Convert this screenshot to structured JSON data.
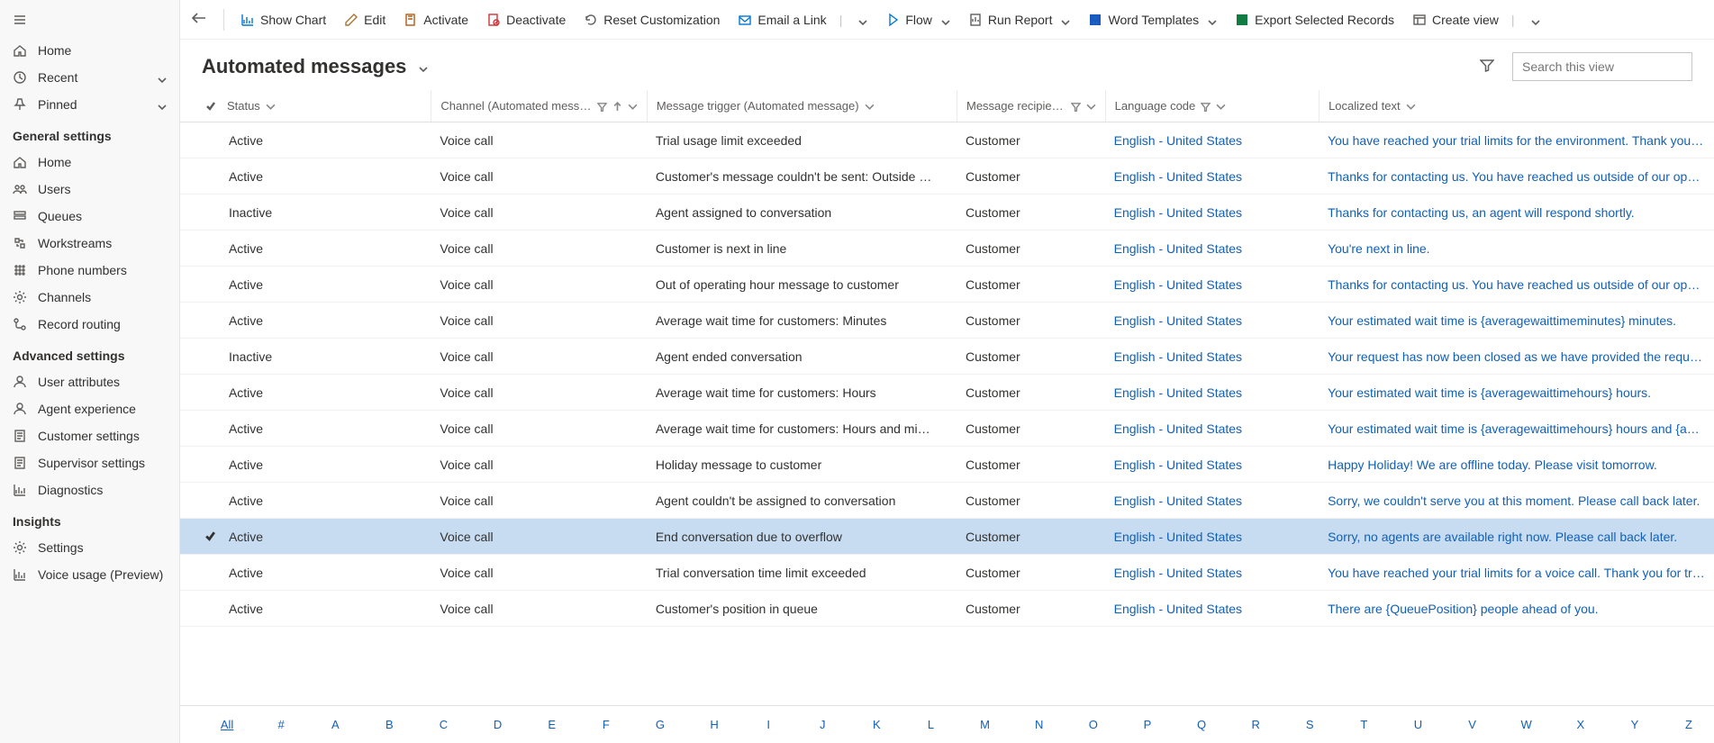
{
  "sidebar": {
    "top": [
      {
        "label": "Home",
        "icon": "home"
      },
      {
        "label": "Recent",
        "icon": "clock",
        "hasChevron": true
      },
      {
        "label": "Pinned",
        "icon": "pin",
        "hasChevron": true
      }
    ],
    "general": {
      "header": "General settings",
      "items": [
        {
          "label": "Home",
          "icon": "home"
        },
        {
          "label": "Users",
          "icon": "users"
        },
        {
          "label": "Queues",
          "icon": "queue"
        },
        {
          "label": "Workstreams",
          "icon": "workstream"
        },
        {
          "label": "Phone numbers",
          "icon": "dialpad"
        },
        {
          "label": "Channels",
          "icon": "gear"
        },
        {
          "label": "Record routing",
          "icon": "route"
        }
      ]
    },
    "advanced": {
      "header": "Advanced settings",
      "items": [
        {
          "label": "User attributes",
          "icon": "person"
        },
        {
          "label": "Agent experience",
          "icon": "person"
        },
        {
          "label": "Customer settings",
          "icon": "form"
        },
        {
          "label": "Supervisor settings",
          "icon": "form"
        },
        {
          "label": "Diagnostics",
          "icon": "chart"
        }
      ]
    },
    "insights": {
      "header": "Insights",
      "items": [
        {
          "label": "Settings",
          "icon": "gear"
        },
        {
          "label": "Voice usage (Preview)",
          "icon": "chart"
        }
      ]
    }
  },
  "toolbar": [
    {
      "label": "Show Chart",
      "icon": "chart",
      "color": "#0078d4"
    },
    {
      "label": "Edit",
      "icon": "edit",
      "color": "#a67734"
    },
    {
      "label": "Activate",
      "icon": "activate",
      "color": "#b35b0f"
    },
    {
      "label": "Deactivate",
      "icon": "deactivate",
      "color": "#d13438"
    },
    {
      "label": "Reset Customization",
      "icon": "reset",
      "color": "#605e5c"
    },
    {
      "label": "Email a Link",
      "icon": "email",
      "color": "#0078d4",
      "split": true
    },
    {
      "label": "Flow",
      "icon": "flow",
      "color": "#0078d4",
      "dropdown": true
    },
    {
      "label": "Run Report",
      "icon": "report",
      "color": "#605e5c",
      "dropdown": true
    },
    {
      "label": "Word Templates",
      "icon": "word",
      "color": "#185abd",
      "dropdown": true
    },
    {
      "label": "Export Selected Records",
      "icon": "excel",
      "color": "#107c41"
    },
    {
      "label": "Create view",
      "icon": "createview",
      "color": "#605e5c",
      "split": true
    }
  ],
  "view": {
    "title": "Automated messages"
  },
  "search": {
    "placeholder": "Search this view"
  },
  "columns": {
    "status": "Status",
    "channel": "Channel (Automated message)",
    "trigger": "Message trigger (Automated message)",
    "recipient": "Message recipient (…",
    "lang": "Language code",
    "localized": "Localized text"
  },
  "rows": [
    {
      "status": "Active",
      "channel": "Voice call",
      "trigger": "Trial usage limit exceeded",
      "recipient": "Customer",
      "lang": "English - United States",
      "localized": "You have reached your trial limits for the environment. Thank you for"
    },
    {
      "status": "Active",
      "channel": "Voice call",
      "trigger": "Customer's message couldn't be sent: Outside …",
      "recipient": "Customer",
      "lang": "English - United States",
      "localized": "Thanks for contacting us. You have reached us outside of our operatin"
    },
    {
      "status": "Inactive",
      "channel": "Voice call",
      "trigger": "Agent assigned to conversation",
      "recipient": "Customer",
      "lang": "English - United States",
      "localized": "Thanks for contacting us, an agent will respond shortly."
    },
    {
      "status": "Active",
      "channel": "Voice call",
      "trigger": "Customer is next in line",
      "recipient": "Customer",
      "lang": "English - United States",
      "localized": "You're next in line."
    },
    {
      "status": "Active",
      "channel": "Voice call",
      "trigger": "Out of operating hour message to customer",
      "recipient": "Customer",
      "lang": "English - United States",
      "localized": "Thanks for contacting us. You have reached us outside of our operatin"
    },
    {
      "status": "Active",
      "channel": "Voice call",
      "trigger": "Average wait time for customers: Minutes",
      "recipient": "Customer",
      "lang": "English - United States",
      "localized": "Your estimated wait time is {averagewaittimeminutes} minutes."
    },
    {
      "status": "Inactive",
      "channel": "Voice call",
      "trigger": "Agent ended conversation",
      "recipient": "Customer",
      "lang": "English - United States",
      "localized": "Your request has now been closed as we have provided the required i"
    },
    {
      "status": "Active",
      "channel": "Voice call",
      "trigger": "Average wait time for customers: Hours",
      "recipient": "Customer",
      "lang": "English - United States",
      "localized": "Your estimated wait time is {averagewaittimehours} hours."
    },
    {
      "status": "Active",
      "channel": "Voice call",
      "trigger": "Average wait time for customers: Hours and mi…",
      "recipient": "Customer",
      "lang": "English - United States",
      "localized": "Your estimated wait time is {averagewaittimehours} hours and {averag"
    },
    {
      "status": "Active",
      "channel": "Voice call",
      "trigger": "Holiday message to customer",
      "recipient": "Customer",
      "lang": "English - United States",
      "localized": "Happy Holiday! We are offline today. Please visit tomorrow."
    },
    {
      "status": "Active",
      "channel": "Voice call",
      "trigger": "Agent couldn't be assigned to conversation",
      "recipient": "Customer",
      "lang": "English - United States",
      "localized": "Sorry, we couldn't serve you at this moment. Please call back later."
    },
    {
      "status": "Active",
      "channel": "Voice call",
      "trigger": "End conversation due to overflow",
      "recipient": "Customer",
      "lang": "English - United States",
      "localized": "Sorry, no agents are available right now. Please call back later.",
      "selected": true
    },
    {
      "status": "Active",
      "channel": "Voice call",
      "trigger": "Trial conversation time limit exceeded",
      "recipient": "Customer",
      "lang": "English - United States",
      "localized": "You have reached your trial limits for a voice call. Thank you for trying"
    },
    {
      "status": "Active",
      "channel": "Voice call",
      "trigger": "Customer's position in queue",
      "recipient": "Customer",
      "lang": "English - United States",
      "localized": "There are {QueuePosition} people ahead of you."
    }
  ],
  "pager": [
    "All",
    "#",
    "A",
    "B",
    "C",
    "D",
    "E",
    "F",
    "G",
    "H",
    "I",
    "J",
    "K",
    "L",
    "M",
    "N",
    "O",
    "P",
    "Q",
    "R",
    "S",
    "T",
    "U",
    "V",
    "W",
    "X",
    "Y",
    "Z"
  ],
  "pagerActive": 0
}
